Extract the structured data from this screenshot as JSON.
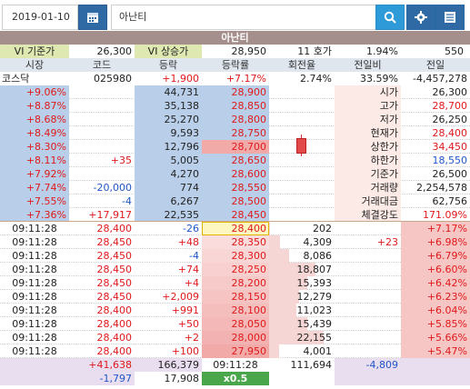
{
  "search": {
    "date": "2019-01-10",
    "stock_name": "아난티"
  },
  "title": "아난티",
  "vi": {
    "base_label": "VI 기준가",
    "base_value": "26,300",
    "upper_label": "VI 상승가",
    "upper_value": "28,950",
    "hoga": "11 호가",
    "pct": "1.94%",
    "right": "550"
  },
  "headers": [
    "시장",
    "코드",
    "등락",
    "등락률",
    "회전율",
    "전일비",
    "전일"
  ],
  "info": {
    "market": "코스닥",
    "code": "025980",
    "change": "+1,900",
    "rate": "+7.17%",
    "turnover": "2.74%",
    "prev_ratio": "33.59%",
    "prev": "-4,457,278"
  },
  "asks": [
    {
      "pct": "+9.06%",
      "diff": "",
      "qty": "44,731",
      "price": "28,900"
    },
    {
      "pct": "+8.87%",
      "diff": "",
      "qty": "35,138",
      "price": "28,850"
    },
    {
      "pct": "+8.68%",
      "diff": "",
      "qty": "25,270",
      "price": "28,800"
    },
    {
      "pct": "+8.49%",
      "diff": "",
      "qty": "9,593",
      "price": "28,750"
    },
    {
      "pct": "+8.30%",
      "diff": "",
      "qty": "12,796",
      "price": "28,700"
    },
    {
      "pct": "+8.11%",
      "diff": "+35",
      "qty": "5,005",
      "price": "28,650"
    },
    {
      "pct": "+7.92%",
      "diff": "",
      "qty": "4,270",
      "price": "28,600"
    },
    {
      "pct": "+7.74%",
      "diff": "-20,000",
      "qty": "774",
      "price": "28,550"
    },
    {
      "pct": "+7.55%",
      "diff": "-4",
      "qty": "6,267",
      "price": "28,500"
    },
    {
      "pct": "+7.36%",
      "diff": "+17,917",
      "qty": "22,535",
      "price": "28,450"
    }
  ],
  "stats": [
    {
      "label": "시가",
      "value": "26,300",
      "color": "#222"
    },
    {
      "label": "고가",
      "value": "28,700",
      "color": "#e0191b"
    },
    {
      "label": "저가",
      "value": "26,250",
      "color": "#222"
    },
    {
      "label": "현재가",
      "value": "28,400",
      "color": "#e0191b"
    },
    {
      "label": "상한가",
      "value": "34,450",
      "color": "#e0191b"
    },
    {
      "label": "하한가",
      "value": "18,550",
      "color": "#2056c8"
    },
    {
      "label": "기준가",
      "value": "26,500",
      "color": "#222"
    },
    {
      "label": "거래량",
      "value": "2,254,578",
      "color": "#222"
    },
    {
      "label": "거래대금",
      "value": "62,756",
      "color": "#222"
    },
    {
      "label": "체결강도",
      "value": "171.09%",
      "color": "#e0191b"
    }
  ],
  "bids": [
    {
      "time": "09:11:28",
      "price": "28,400",
      "chg": "-26",
      "bprice": "28,400",
      "bqty": "202",
      "bdiff": "",
      "bpct": "+7.17%"
    },
    {
      "time": "09:11:28",
      "price": "28,450",
      "chg": "+48",
      "bprice": "28,350",
      "bqty": "4,309",
      "bdiff": "+23",
      "bpct": "+6.98%"
    },
    {
      "time": "09:11:28",
      "price": "28,450",
      "chg": "-4",
      "bprice": "28,300",
      "bqty": "8,086",
      "bdiff": "",
      "bpct": "+6.79%"
    },
    {
      "time": "09:11:28",
      "price": "28,450",
      "chg": "+74",
      "bprice": "28,250",
      "bqty": "18,807",
      "bdiff": "",
      "bpct": "+6.60%"
    },
    {
      "time": "09:11:28",
      "price": "28,450",
      "chg": "+4",
      "bprice": "28,200",
      "bqty": "15,393",
      "bdiff": "",
      "bpct": "+6.42%"
    },
    {
      "time": "09:11:28",
      "price": "28,450",
      "chg": "+2,009",
      "bprice": "28,150",
      "bqty": "12,279",
      "bdiff": "",
      "bpct": "+6.23%"
    },
    {
      "time": "09:11:28",
      "price": "28,400",
      "chg": "+991",
      "bprice": "28,100",
      "bqty": "11,023",
      "bdiff": "",
      "bpct": "+6.04%"
    },
    {
      "time": "09:11:28",
      "price": "28,400",
      "chg": "+50",
      "bprice": "28,050",
      "bqty": "15,439",
      "bdiff": "",
      "bpct": "+5.85%"
    },
    {
      "time": "09:11:28",
      "price": "28,400",
      "chg": "+2",
      "bprice": "28,000",
      "bqty": "22,155",
      "bdiff": "",
      "bpct": "+5.66%"
    },
    {
      "time": "09:11:28",
      "price": "28,400",
      "chg": "+100",
      "bprice": "27,950",
      "bqty": "4,001",
      "bdiff": "",
      "bpct": "+5.47%"
    }
  ],
  "totals": {
    "ask_diff": "+41,638",
    "ask_total": "166,379",
    "time": "09:11:28",
    "bid_total": "111,694",
    "bid_diff": "-4,809"
  },
  "totals2": {
    "diff": "-1,797",
    "vol": "17,908",
    "speed": "x0.5"
  },
  "colors": {
    "accent": "#2f6aa5",
    "search": "#2e9ad7",
    "title_bar": "#a58f8c",
    "up": "#e0191b",
    "down": "#2056c8"
  }
}
